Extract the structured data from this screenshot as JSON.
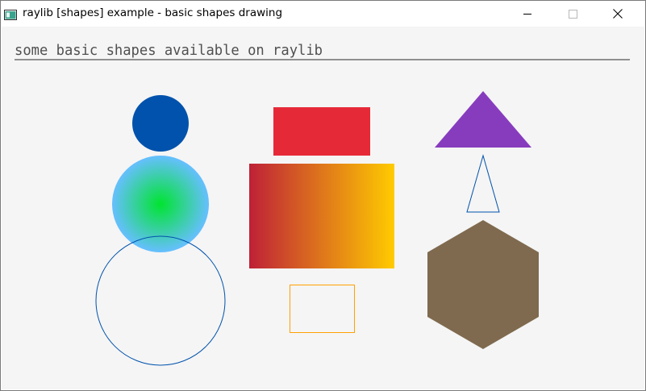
{
  "window": {
    "title": "raylib [shapes] example - basic shapes drawing"
  },
  "canvas": {
    "heading": "some basic shapes available on raylib",
    "background": "#f5f5f5"
  },
  "colors": {
    "dark_blue": "#0052ac",
    "sky_blue": "#66bfff",
    "green": "#00e430",
    "red": "#e62937",
    "maroon": "#be2137",
    "gold": "#ffcb00",
    "orange": "#ffa100",
    "violet": "#873cbe",
    "brown": "#7f6a4f",
    "text_dark": "#505050"
  },
  "icons": {
    "app": "app-window-icon",
    "minimize": "minimize-icon",
    "maximize": "maximize-icon",
    "close": "close-icon"
  }
}
